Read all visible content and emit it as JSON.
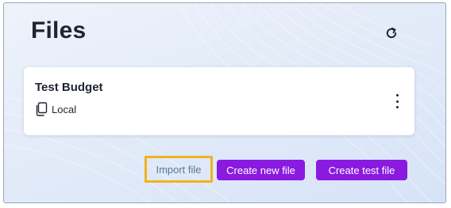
{
  "header": {
    "title": "Files",
    "refresh_icon": "refresh-icon"
  },
  "files": [
    {
      "name": "Test Budget",
      "location": "Local",
      "location_icon": "files-copy-icon",
      "menu_icon": "vertical-dots-icon"
    }
  ],
  "actions": {
    "import_label": "Import file",
    "create_new_label": "Create new file",
    "create_test_label": "Create test file"
  },
  "colors": {
    "primary": "#8a1ae0",
    "highlight": "#f2b21c",
    "text": "#1e2530",
    "import_text": "#5a7896"
  }
}
